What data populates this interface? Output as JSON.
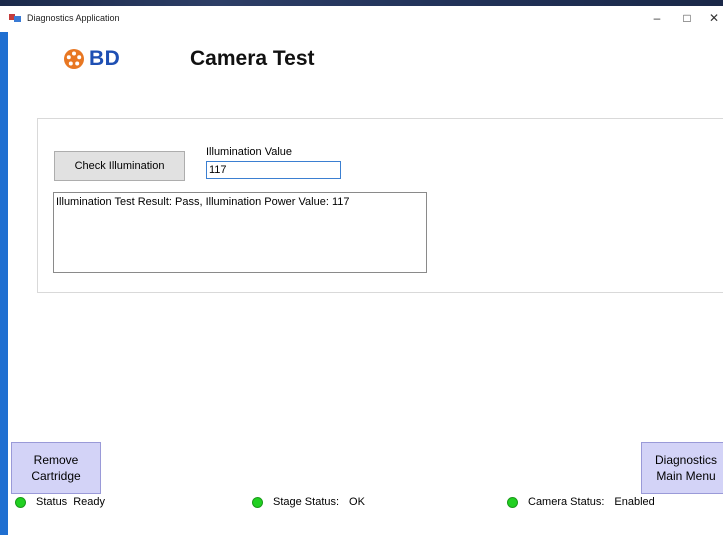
{
  "window": {
    "title": "Diagnostics Application",
    "controls": [
      "–",
      "□",
      "✕"
    ]
  },
  "brand": {
    "logo_text": "BD",
    "logo_color": "#e87722",
    "text_color": "#1e4fb3"
  },
  "page": {
    "title": "Camera Test"
  },
  "illumination": {
    "check_button_label": "Check Illumination",
    "value_label": "Illumination Value",
    "value": "117",
    "result_text": "Illumination Test Result: Pass, Illumination Power Value: 117"
  },
  "navigation": {
    "remove_cartridge_label": "Remove Cartridge",
    "diagnostics_main_menu_label": "Diagnostics Main Menu"
  },
  "status": {
    "status_label": "Status",
    "status_value": "Ready",
    "stage_label": "Stage Status:",
    "stage_value": "OK",
    "camera_label": "Camera Status:",
    "camera_value": "Enabled",
    "indicator_color": "#21d021"
  }
}
